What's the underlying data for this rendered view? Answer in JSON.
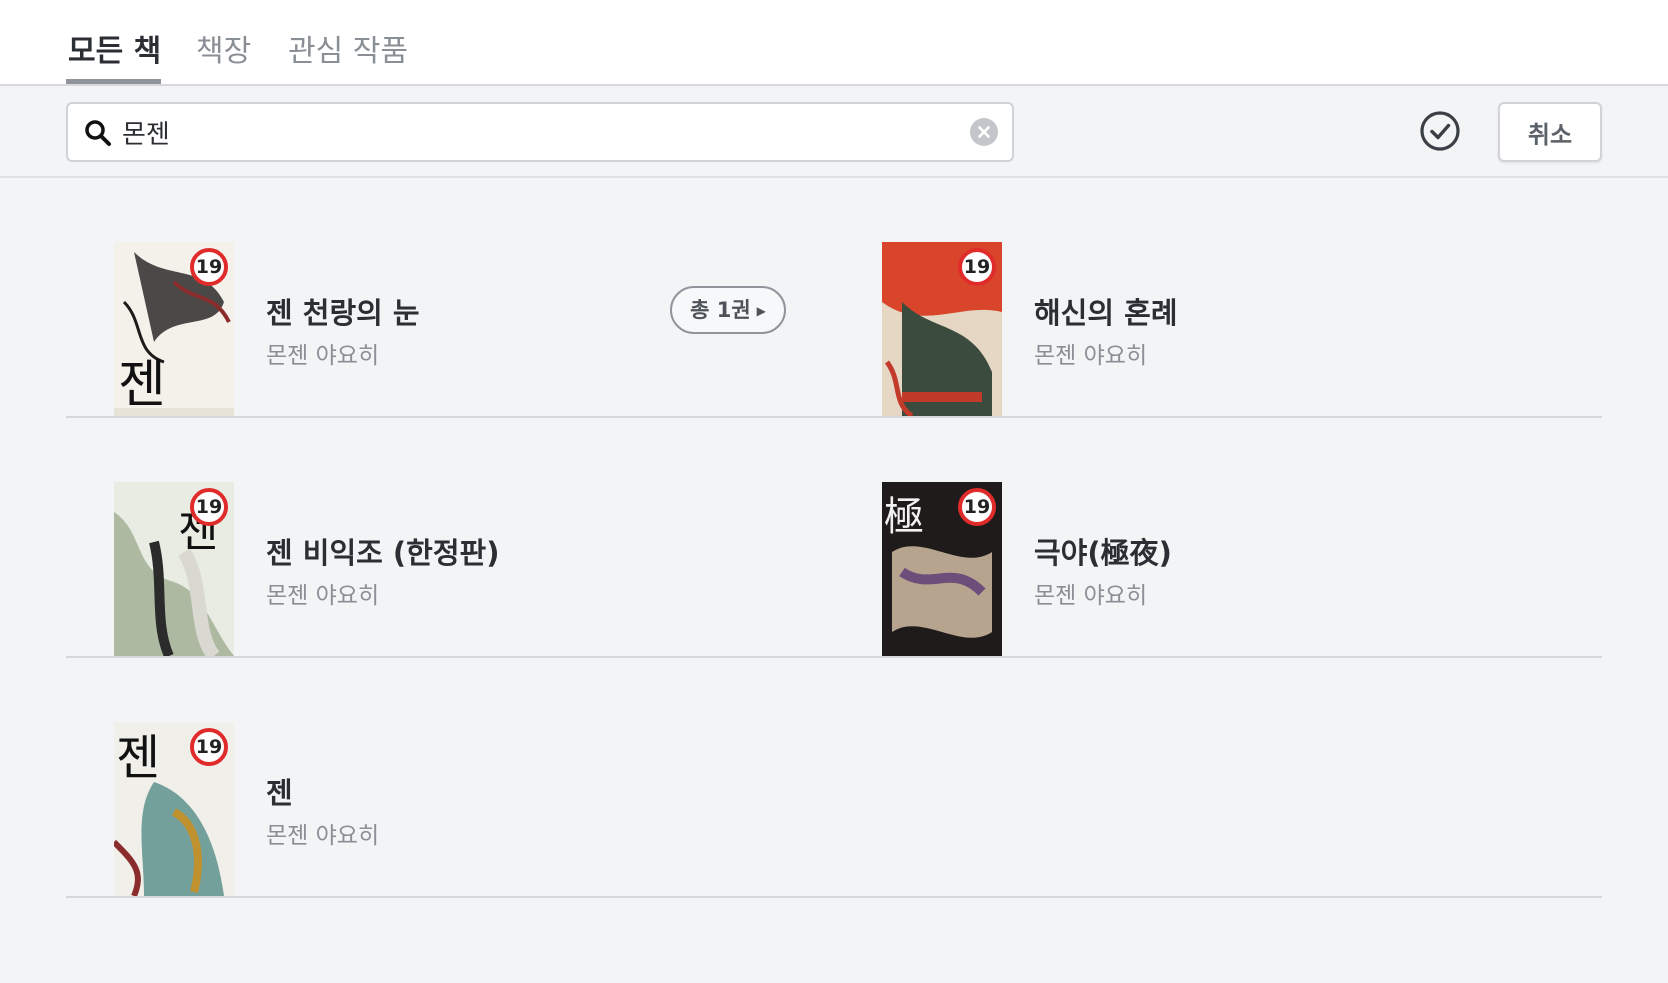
{
  "tabs": [
    {
      "label": "모든 책",
      "active": true
    },
    {
      "label": "책장",
      "active": false
    },
    {
      "label": "관심 작품",
      "active": false
    }
  ],
  "search": {
    "value": "몬젠",
    "icon": "search-icon",
    "clear_icon": "clear-circle-icon"
  },
  "toolbar": {
    "select_icon": "check-circle-icon",
    "cancel_label": "취소"
  },
  "books": [
    {
      "title": "젠 천랑의 눈",
      "author": "몬젠 야요히",
      "age_rating": "19",
      "count_label": "총 1권",
      "cover_text": "젠",
      "cover_colors": [
        "#f4f1ea",
        "#1b1b1b",
        "#8b2c2c"
      ]
    },
    {
      "title": "해신의 혼례",
      "author": "몬젠 야요히",
      "age_rating": "19",
      "count_label": "",
      "cover_text": "",
      "cover_colors": [
        "#d9452b",
        "#3b4b3e",
        "#e6d6c4"
      ]
    },
    {
      "title": "젠 비익조 (한정판)",
      "author": "몬젠 야요히",
      "age_rating": "19",
      "count_label": "",
      "cover_text": "젠",
      "cover_colors": [
        "#e8ece2",
        "#2b2b2b",
        "#7c8f6a"
      ]
    },
    {
      "title": "극야(極夜)",
      "author": "몬젠 야요히",
      "age_rating": "19",
      "count_label": "",
      "cover_text": "極",
      "cover_colors": [
        "#1f1b1a",
        "#b7a48f",
        "#6d4d7a"
      ]
    },
    {
      "title": "젠",
      "author": "몬젠 야요히",
      "age_rating": "19",
      "count_label": "",
      "cover_text": "젠",
      "cover_colors": [
        "#f1efe9",
        "#2a2a2a",
        "#3f7f7a"
      ]
    }
  ],
  "colors": {
    "accent_tab": "#2b2f34",
    "age_badge_border": "#e02b2b",
    "background": "#f3f4f6"
  }
}
